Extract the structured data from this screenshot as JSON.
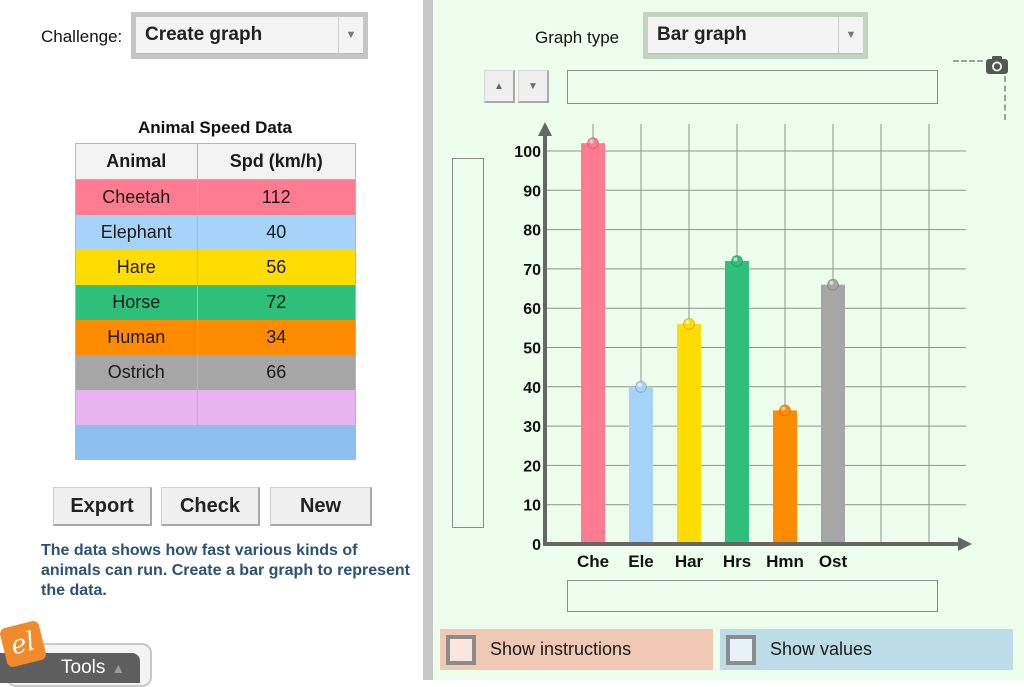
{
  "left": {
    "challenge_label": "Challenge:",
    "challenge_select": {
      "value": "Create graph",
      "arrow_icon": "triangle-down"
    },
    "table": {
      "title": "Animal Speed Data",
      "headers": [
        "Animal",
        "Spd (km/h)"
      ],
      "rows": [
        {
          "animal": "Cheetah",
          "speed": "112",
          "color": "#ff7b90"
        },
        {
          "animal": "Elephant",
          "speed": "40",
          "color": "#a5d3fa"
        },
        {
          "animal": "Hare",
          "speed": "56",
          "color": "#ffdd00"
        },
        {
          "animal": "Horse",
          "speed": "72",
          "color": "#2ebf7a"
        },
        {
          "animal": "Human",
          "speed": "34",
          "color": "#ff8c00"
        },
        {
          "animal": "Ostrich",
          "speed": "66",
          "color": "#a6a6a6"
        },
        {
          "animal": "",
          "speed": "",
          "color": "#e8b4f0"
        },
        {
          "animal": "",
          "speed": "",
          "color": "#8cc0ee"
        }
      ]
    },
    "buttons": {
      "export": "Export",
      "check": "Check",
      "new": "New"
    },
    "instructions": "The data shows how fast various kinds of animals can run. Create a bar graph to represent the data.",
    "tools": {
      "label": "Tools",
      "arrow_icon": "triangle-up",
      "logo_text": "el"
    }
  },
  "right": {
    "graph_type_label": "Graph type",
    "graph_type_select": {
      "value": "Bar graph",
      "arrow_icon": "triangle-down"
    },
    "scale_up_icon": "▲",
    "scale_down_icon": "▼",
    "title_field": {
      "value": ""
    },
    "y_label_field": {
      "value": ""
    },
    "x_label_field": {
      "value": ""
    },
    "camera_icon": "camera",
    "show_instructions": {
      "label": "Show instructions",
      "checked": false,
      "bg": "#f0c8b4"
    },
    "show_values": {
      "label": "Show values",
      "checked": false,
      "bg": "#bcdce8"
    }
  },
  "chart_data": {
    "type": "bar",
    "title": "",
    "xlabel": "",
    "ylabel": "",
    "categories": [
      "Che",
      "Ele",
      "Har",
      "Hrs",
      "Hmn",
      "Ost"
    ],
    "values": [
      102,
      40,
      56,
      72,
      34,
      66
    ],
    "colors": [
      "#ff7b90",
      "#a5d3fa",
      "#ffdd00",
      "#2ebf7a",
      "#ff8c00",
      "#a6a6a6"
    ],
    "yticks": [
      0,
      10,
      20,
      30,
      40,
      50,
      60,
      70,
      80,
      90,
      100
    ],
    "ylim": [
      0,
      100
    ],
    "slots": 8,
    "grid": true,
    "legend": "none"
  }
}
